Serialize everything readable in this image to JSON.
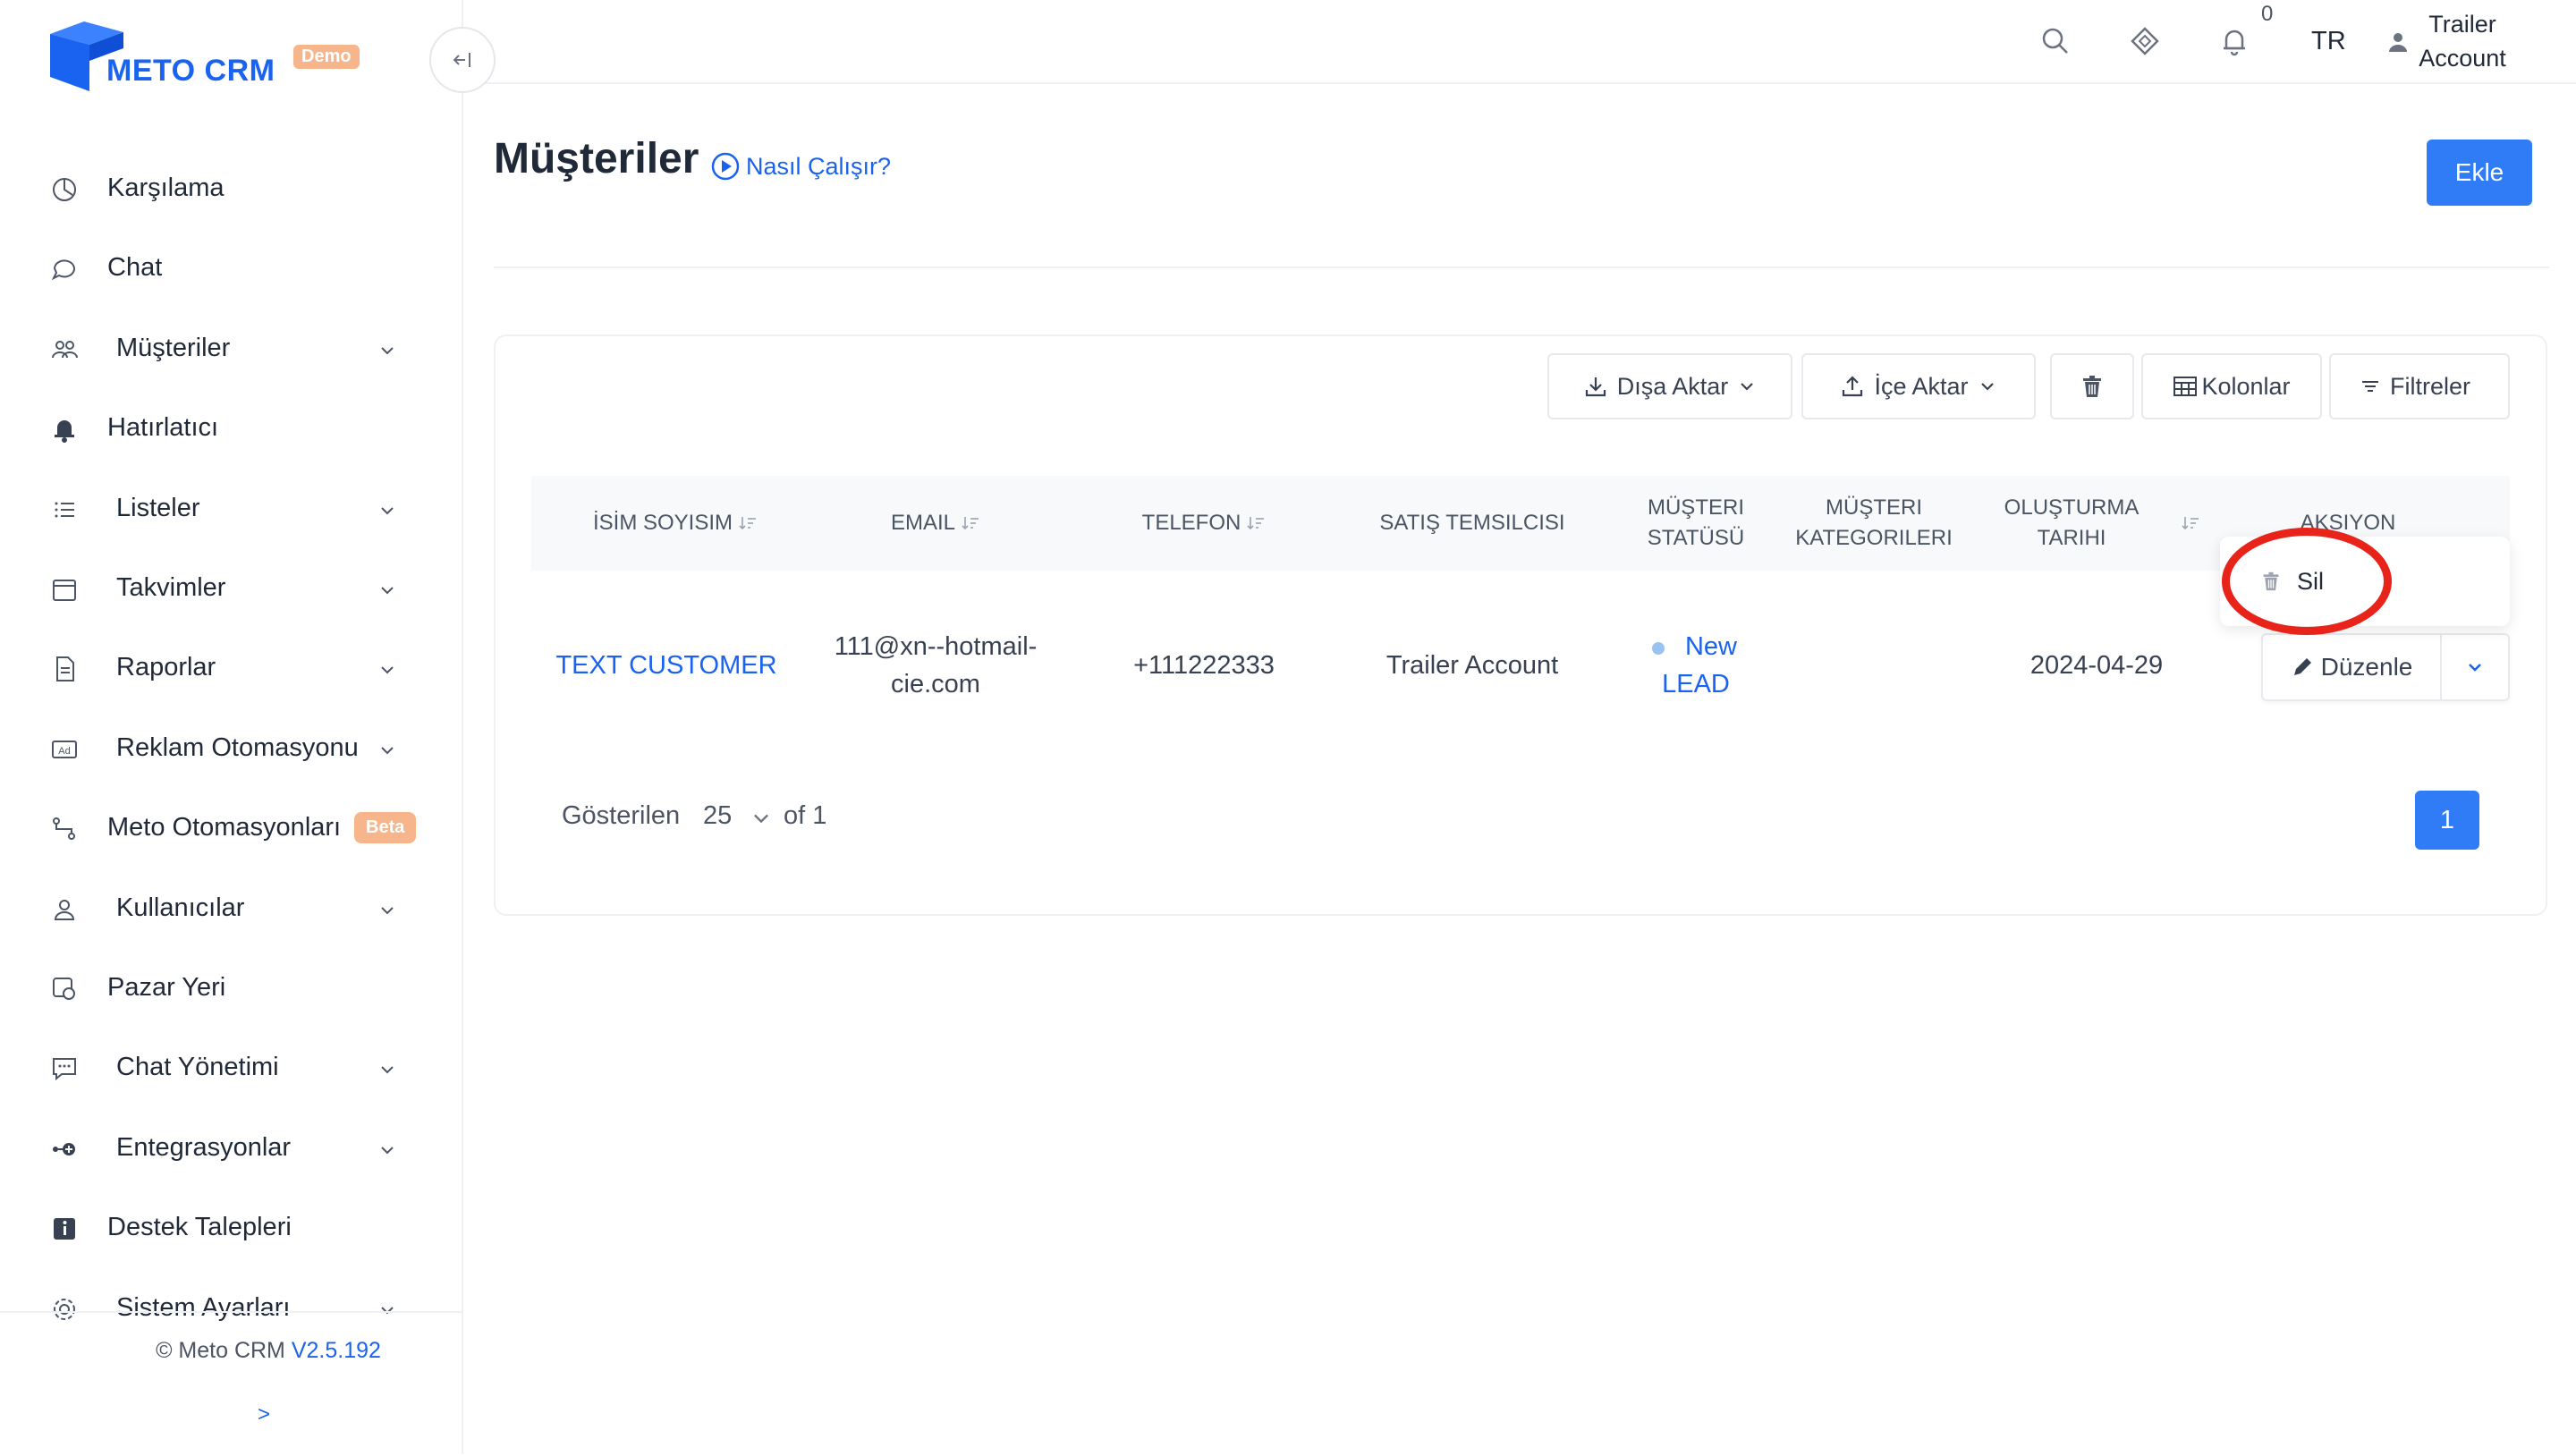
{
  "brand": {
    "name": "METO CRM",
    "badge": "Demo"
  },
  "colors": {
    "accent": "#2f7cf6",
    "brand": "#1a62f0",
    "highlight": "#e8231a",
    "beta": "#f6b58a"
  },
  "sidebar": {
    "collapse_icon": "collapse-left-icon",
    "items": [
      {
        "label": "Karşılama",
        "icon": "dashboard-icon",
        "expandable": false
      },
      {
        "label": "Chat",
        "icon": "chat-bubble-icon",
        "expandable": false
      },
      {
        "label": "Müşteriler",
        "icon": "users-icon",
        "expandable": true
      },
      {
        "label": "Hatırlatıcı",
        "icon": "bell-icon",
        "expandable": false
      },
      {
        "label": "Listeler",
        "icon": "list-icon",
        "expandable": true
      },
      {
        "label": "Takvimler",
        "icon": "calendar-icon",
        "expandable": true
      },
      {
        "label": "Raporlar",
        "icon": "report-icon",
        "expandable": true
      },
      {
        "label": "Reklam Otomasyonu",
        "icon": "ad-icon",
        "expandable": true
      },
      {
        "label": "Meto Otomasyonları",
        "icon": "automation-icon",
        "expandable": false,
        "badge": "Beta"
      },
      {
        "label": "Kullanıcılar",
        "icon": "user-icon",
        "expandable": true
      },
      {
        "label": "Pazar Yeri",
        "icon": "marketplace-icon",
        "expandable": false
      },
      {
        "label": "Chat Yönetimi",
        "icon": "chat-manage-icon",
        "expandable": true
      },
      {
        "label": "Entegrasyonlar",
        "icon": "integration-icon",
        "expandable": true
      },
      {
        "label": "Destek Talepleri",
        "icon": "info-icon",
        "expandable": false
      },
      {
        "label": "Sistem Ayarları",
        "icon": "gear-icon",
        "expandable": true
      }
    ],
    "footer": {
      "copyright": "© Meto CRM",
      "version": "V2.5.192",
      "expand": ">"
    }
  },
  "header": {
    "notification_count": "0",
    "language": "TR",
    "user_line1": "Trailer",
    "user_line2": "Account"
  },
  "page": {
    "title": "Müşteriler",
    "howto": "Nasıl Çalışır?",
    "add_button": "Ekle"
  },
  "toolbar": {
    "export": "Dışa Aktar",
    "import": "İçe Aktar",
    "columns": "Kolonlar",
    "filters": "Filtreler"
  },
  "table": {
    "columns": [
      {
        "line1": "İSİM SOYISIM",
        "line2": "",
        "sortable": true
      },
      {
        "line1": "EMAIL",
        "line2": "",
        "sortable": true
      },
      {
        "line1": "TELEFON",
        "line2": "",
        "sortable": true
      },
      {
        "line1": "SATIŞ TEMSILCISI",
        "line2": "",
        "sortable": false
      },
      {
        "line1": "MÜŞTERI",
        "line2": "STATÜSÜ",
        "sortable": false
      },
      {
        "line1": "MÜŞTERI",
        "line2": "KATEGORILERI",
        "sortable": false
      },
      {
        "line1": "OLUŞTURMA TARIHI",
        "line2": "",
        "sortable": true
      },
      {
        "line1": "AKSIYON",
        "line2": "",
        "sortable": false
      }
    ],
    "rows": [
      {
        "name": "TEXT CUSTOMER",
        "email_line1": "111@xn--hotmail-",
        "email_line2": "cie.com",
        "phone": "+111222333",
        "rep": "Trailer Account",
        "status_line1": "New",
        "status_line2": "LEAD",
        "categories": "",
        "created": "2024-04-29",
        "edit_label": "Düzenle"
      }
    ],
    "action_menu": {
      "delete_label": "Sil"
    }
  },
  "pagination": {
    "shown_label": "Gösterilen",
    "page_size": "25",
    "of_label": "of 1",
    "current_page": "1"
  }
}
